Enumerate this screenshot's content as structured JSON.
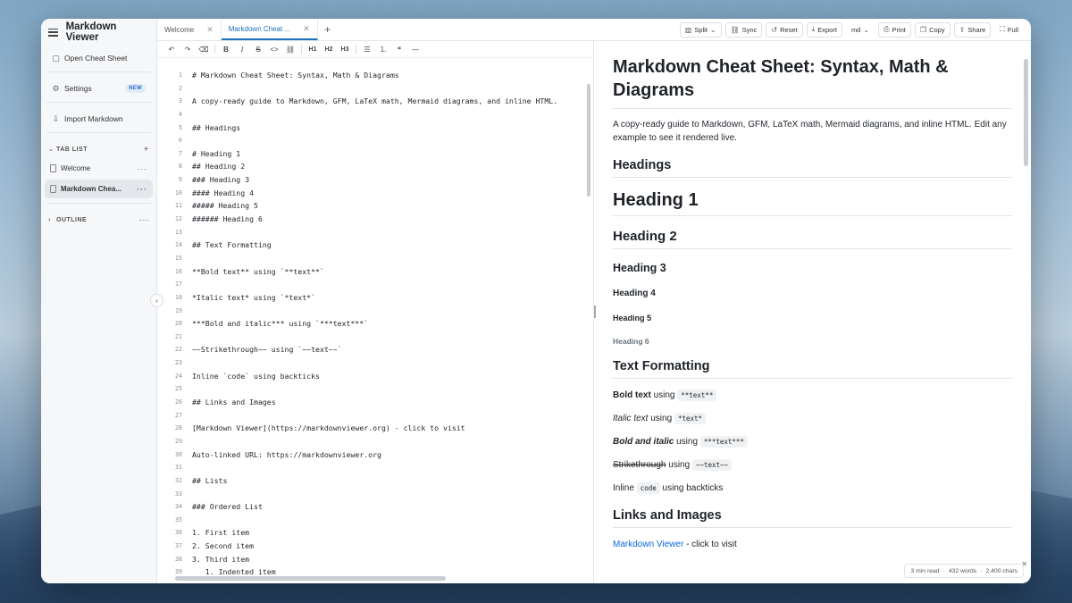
{
  "app": {
    "title": "Markdown Viewer"
  },
  "sidebar": {
    "actions": [
      {
        "label": "Open Cheat Sheet",
        "icon": "file-icon"
      },
      {
        "label": "Settings",
        "icon": "gear-icon",
        "badge": "NEW"
      },
      {
        "label": "Import Markdown",
        "icon": "import-icon"
      }
    ],
    "tab_list_header": "TAB LIST",
    "tabs": [
      {
        "label": "Welcome",
        "active": false
      },
      {
        "label": "Markdown Chea...",
        "active": true
      }
    ],
    "outline_header": "OUTLINE"
  },
  "tabs": [
    {
      "label": "Welcome",
      "active": false
    },
    {
      "label": "Markdown Cheat ...",
      "active": true
    }
  ],
  "toolbar": {
    "split": "Split",
    "sync": "Sync",
    "reset": "Reset",
    "export": "Export",
    "format": "md",
    "print": "Print",
    "copy": "Copy",
    "share": "Share",
    "full": "Full"
  },
  "format_bar": [
    "undo-icon",
    "redo-icon",
    "eraser-icon",
    "B",
    "I",
    "S",
    "<>",
    "link-icon",
    "H1",
    "H2",
    "H3",
    "list-icon",
    "ordered-list-icon",
    "quote-icon",
    "—"
  ],
  "editor": {
    "lines": [
      "# Markdown Cheat Sheet: Syntax, Math & Diagrams",
      "",
      "A copy-ready guide to Markdown, GFM, LaTeX math, Mermaid diagrams, and inline HTML.",
      "",
      "## Headings",
      "",
      "# Heading 1",
      "## Heading 2",
      "### Heading 3",
      "#### Heading 4",
      "##### Heading 5",
      "###### Heading 6",
      "",
      "## Text Formatting",
      "",
      "**Bold text** using `**text**`",
      "",
      "*Italic text* using `*text*`",
      "",
      "***Bold and italic*** using `***text***`",
      "",
      "~~Strikethrough~~ using `~~text~~`",
      "",
      "Inline `code` using backticks",
      "",
      "## Links and Images",
      "",
      "[Markdown Viewer](https://markdownviewer.org) - click to visit",
      "",
      "Auto-linked URL: https://markdownviewer.org",
      "",
      "## Lists",
      "",
      "### Ordered List",
      "",
      "1. First item",
      "2. Second item",
      "3. Third item",
      "   1. Indented item"
    ]
  },
  "preview": {
    "title": "Markdown Cheat Sheet: Syntax, Math & Diagrams",
    "intro": "A copy-ready guide to Markdown, GFM, LaTeX math, Mermaid diagrams, and inline HTML. Edit any example to see it rendered live.",
    "headings_title": "Headings",
    "h1": "Heading 1",
    "h2": "Heading 2",
    "h3": "Heading 3",
    "h4": "Heading 4",
    "h5": "Heading 5",
    "h6": "Heading 6",
    "text_formatting_title": "Text Formatting",
    "bold_text": "Bold text",
    "bold_code": "**text**",
    "italic_text": "Italic text",
    "italic_code": "*text*",
    "bolditalic_text": "Bold and italic",
    "bolditalic_code": "***text***",
    "strike_text": "Strikethrough",
    "strike_code": "~~text~~",
    "inline_prefix": "Inline",
    "inline_code": "code",
    "inline_suffix": "using backticks",
    "using": "using",
    "links_title": "Links and Images",
    "link_text": "Markdown Viewer",
    "link_suffix": " - click to visit"
  },
  "stats": {
    "read": "3 min read",
    "words": "432 words",
    "chars": "2,400 chars"
  }
}
